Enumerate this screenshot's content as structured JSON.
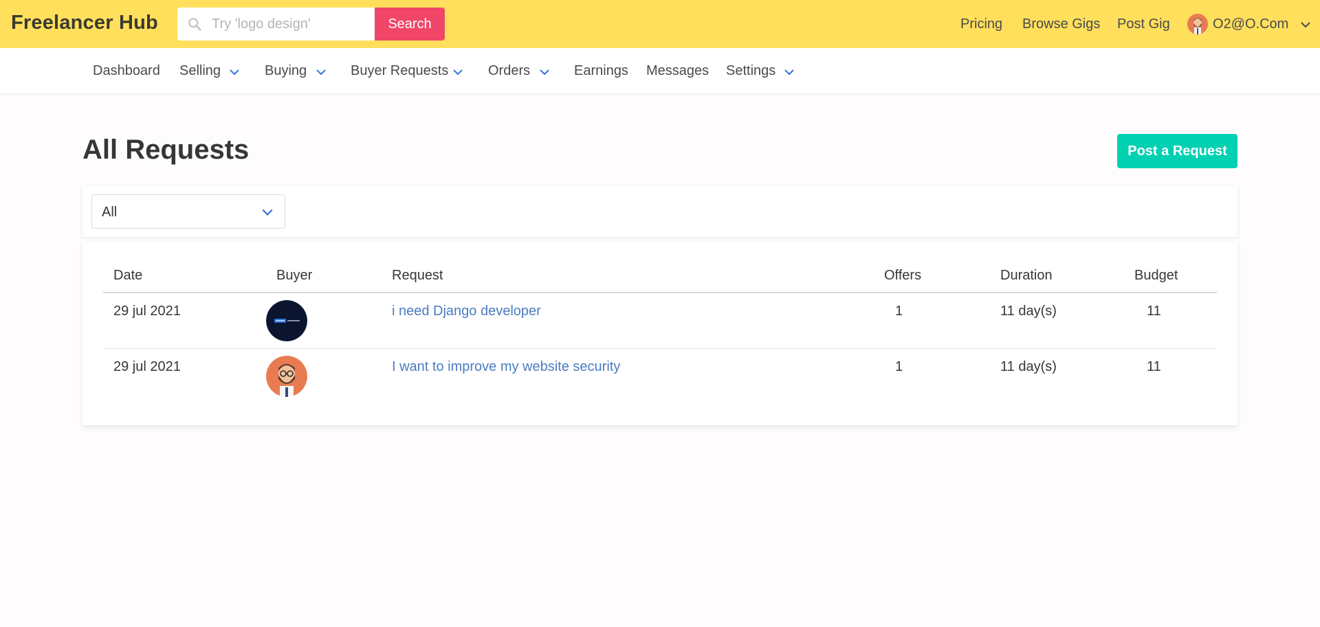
{
  "brand": "Freelancer Hub",
  "search": {
    "placeholder": "Try 'logo design'",
    "value": "",
    "button_label": "Search"
  },
  "top_nav": {
    "links": [
      "Pricing",
      "Browse Gigs",
      "Post Gig"
    ],
    "user_label": "O2@O.Com"
  },
  "sub_nav": {
    "items": [
      {
        "label": "Dashboard",
        "dropdown": false
      },
      {
        "label": "Selling",
        "dropdown": true
      },
      {
        "label": "Buying",
        "dropdown": true
      },
      {
        "label": "Buyer Requests",
        "dropdown": true
      },
      {
        "label": "Orders",
        "dropdown": true
      },
      {
        "label": "Earnings",
        "dropdown": false
      },
      {
        "label": "Messages",
        "dropdown": false
      },
      {
        "label": "Settings",
        "dropdown": true
      }
    ]
  },
  "main": {
    "title": "All Requests",
    "post_button_label": "Post a Request",
    "filter": {
      "selected": "All"
    },
    "table": {
      "headers": [
        "Date",
        "Buyer",
        "Request",
        "Offers",
        "Duration",
        "Budget"
      ],
      "rows": [
        {
          "date": "29 jul 2021",
          "buyer_avatar": "django-logo-avatar",
          "request": "i need Django developer",
          "offers": "1",
          "duration": "11 day(s)",
          "budget": "11"
        },
        {
          "date": "29 jul 2021",
          "buyer_avatar": "bearded-man-avatar",
          "request": "I want to improve my website security",
          "offers": "1",
          "duration": "11 day(s)",
          "budget": "11"
        }
      ]
    }
  },
  "colors": {
    "topbar": "#ffdf5c",
    "search_button": "#f14668",
    "primary_button": "#00d1b2",
    "link": "#4a7cc0",
    "chevron": "#3273dc"
  }
}
